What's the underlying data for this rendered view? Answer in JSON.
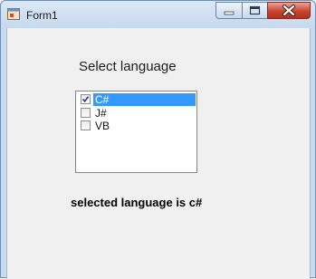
{
  "window": {
    "title": "Form1"
  },
  "form": {
    "select_label": "Select language",
    "languages": [
      {
        "label": "C#",
        "checked": true,
        "selected": true
      },
      {
        "label": "J#",
        "checked": false,
        "selected": false
      },
      {
        "label": "VB",
        "checked": false,
        "selected": false
      }
    ],
    "result_text": "selected language is c#"
  },
  "icons": {
    "app": "form-app-icon",
    "minimize": "minimize-icon",
    "maximize": "maximize-icon",
    "close": "close-icon",
    "check": "check-icon"
  },
  "colors": {
    "selection": "#3399ff",
    "close_button": "#c8442f",
    "titlebar": "#c6d9ee"
  }
}
